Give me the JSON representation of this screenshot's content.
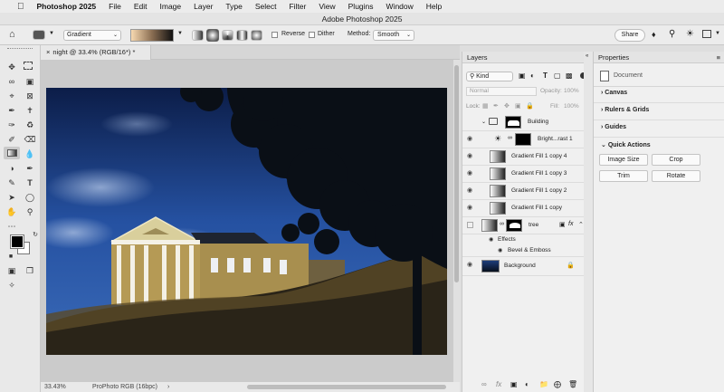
{
  "menubar": {
    "apple_icon": "apple-icon",
    "items": [
      "Photoshop 2025",
      "File",
      "Edit",
      "Image",
      "Layer",
      "Type",
      "Select",
      "Filter",
      "View",
      "Plugins",
      "Window",
      "Help"
    ]
  },
  "window": {
    "title": "Adobe Photoshop 2025"
  },
  "options_bar": {
    "preset": "Gradient",
    "reverse_label": "Reverse",
    "dither_label": "Dither",
    "method_label": "Method:",
    "method_value": "Smooth",
    "share_label": "Share"
  },
  "document": {
    "tab_title": "night @ 33.4% (RGB/16*) *",
    "zoom": "33.43%",
    "profile": "ProPhoto RGB (16bpc)"
  },
  "layers_panel": {
    "tab_label": "Layers",
    "kind_label": "Kind",
    "blend_mode": "Normal",
    "opacity_label": "Opacity:",
    "opacity_value": "100%",
    "lock_label": "Lock:",
    "fill_label": "Fill:",
    "fill_value": "100%",
    "layers": [
      {
        "name": "Building",
        "kind": "group"
      },
      {
        "name": "Bright...rast 1",
        "kind": "adjustment"
      },
      {
        "name": "Gradient Fill 1 copy 4",
        "kind": "fill"
      },
      {
        "name": "Gradient Fill 1 copy 3",
        "kind": "fill"
      },
      {
        "name": "Gradient Fill 1 copy 2",
        "kind": "fill"
      },
      {
        "name": "Gradient Fill 1 copy",
        "kind": "fill"
      },
      {
        "name": "tree",
        "kind": "fill"
      },
      {
        "name": "Background",
        "kind": "image"
      }
    ],
    "effects_label": "Effects",
    "effect_item": "Bevel & Emboss"
  },
  "properties_panel": {
    "tab_label": "Properties",
    "doc_label": "Document",
    "sections": [
      "Canvas",
      "Rulers & Grids",
      "Guides",
      "Quick Actions"
    ],
    "quick_actions": [
      "Image Size",
      "Crop",
      "Trim",
      "Rotate"
    ]
  },
  "colors": {
    "accent": "#1473e6",
    "sky_top": "#0b1a40",
    "sky_mid": "#2b5cae"
  }
}
